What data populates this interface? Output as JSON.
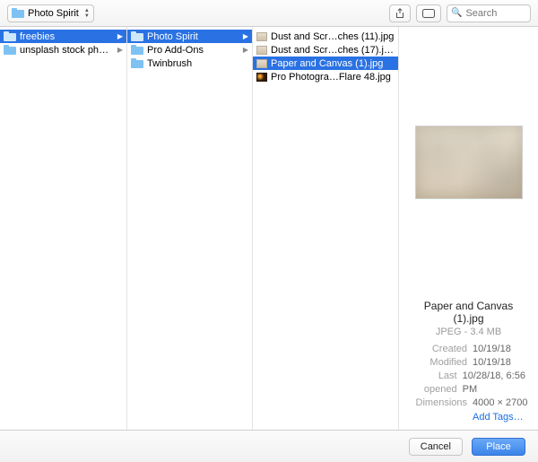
{
  "toolbar": {
    "current_dir": "Photo Spirit",
    "search_placeholder": "Search"
  },
  "columns": {
    "col1": [
      {
        "name": "freebies",
        "selected": true,
        "hasChildren": true
      },
      {
        "name": "unsplash stock photo",
        "selected": false,
        "hasChildren": true
      }
    ],
    "col2": [
      {
        "name": "Photo Spirit",
        "selected": true,
        "hasChildren": true
      },
      {
        "name": "Pro Add-Ons",
        "selected": false,
        "hasChildren": true
      },
      {
        "name": "Twinbrush",
        "selected": false,
        "hasChildren": false
      }
    ],
    "col3": [
      {
        "name": "Dust and Scr…ches (11).jpg",
        "selected": false,
        "thumb": "texture"
      },
      {
        "name": "Dust and Scr…ches (17).jpg",
        "selected": false,
        "thumb": "texture"
      },
      {
        "name": "Paper and Canvas (1).jpg",
        "selected": true,
        "thumb": "texture"
      },
      {
        "name": "Pro Photogra…Flare 48.jpg",
        "selected": false,
        "thumb": "flare"
      }
    ]
  },
  "preview": {
    "filename_l1": "Paper and Canvas",
    "filename_l2": "(1).jpg",
    "type_size": "JPEG - 3.4 MB",
    "labels": {
      "created": "Created",
      "modified": "Modified",
      "last_opened": "Last opened",
      "dimensions": "Dimensions",
      "add_tags": "Add Tags…"
    },
    "values": {
      "created": "10/19/18",
      "modified": "10/19/18",
      "last_opened": "10/28/18, 6:56 PM",
      "dimensions": "4000 × 2700"
    }
  },
  "footer": {
    "cancel": "Cancel",
    "place": "Place"
  }
}
